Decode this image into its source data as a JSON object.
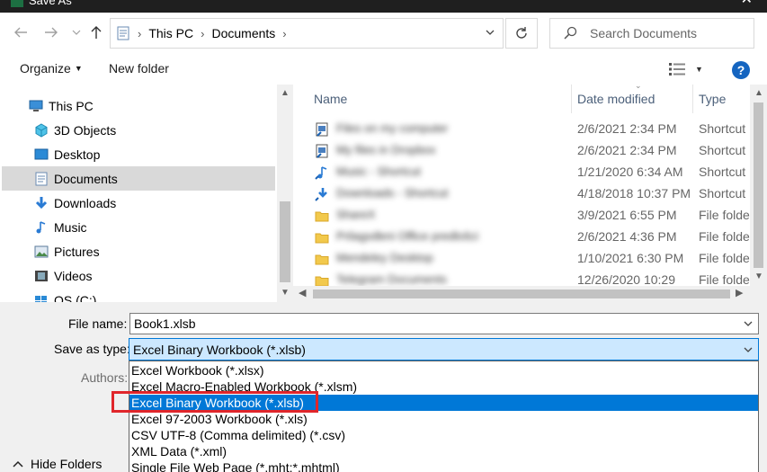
{
  "window": {
    "title": "Save As"
  },
  "address": {
    "crumbs": [
      "This PC",
      "Documents"
    ]
  },
  "search": {
    "placeholder": "Search Documents"
  },
  "toolbar": {
    "organize": "Organize",
    "new_folder": "New folder",
    "help": "?"
  },
  "nav": {
    "items": [
      {
        "label": "This PC",
        "icon": "computer-icon"
      },
      {
        "label": "3D Objects",
        "icon": "cube-icon"
      },
      {
        "label": "Desktop",
        "icon": "desktop-icon"
      },
      {
        "label": "Documents",
        "icon": "documents-icon",
        "selected": true
      },
      {
        "label": "Downloads",
        "icon": "download-icon"
      },
      {
        "label": "Music",
        "icon": "music-icon"
      },
      {
        "label": "Pictures",
        "icon": "pictures-icon"
      },
      {
        "label": "Videos",
        "icon": "videos-icon"
      },
      {
        "label": "OS (C:)",
        "icon": "drive-icon"
      }
    ]
  },
  "files": {
    "headers": {
      "name": "Name",
      "date": "Date modified",
      "type": "Type"
    },
    "rows": [
      {
        "name": "Files on my computer",
        "date": "2/6/2021 2:34 PM",
        "type": "Shortcut",
        "icon": "shortcut-icon"
      },
      {
        "name": "My files in Dropbox",
        "date": "2/6/2021 2:34 PM",
        "type": "Shortcut",
        "icon": "shortcut-icon"
      },
      {
        "name": "Music - Shortcut",
        "date": "1/21/2020 6:34 AM",
        "type": "Shortcut",
        "icon": "music-shortcut-icon"
      },
      {
        "name": "Downloads - Shortcut",
        "date": "4/18/2018 10:37 PM",
        "type": "Shortcut",
        "icon": "download-shortcut-icon"
      },
      {
        "name": "ShareX",
        "date": "3/9/2021 6:55 PM",
        "type": "File folder",
        "icon": "folder-icon"
      },
      {
        "name": "Prilagođeni Office predlošci",
        "date": "2/6/2021 4:36 PM",
        "type": "File folder",
        "icon": "folder-icon"
      },
      {
        "name": "Mendeley Desktop",
        "date": "1/10/2021 6:30 PM",
        "type": "File folder",
        "icon": "folder-icon"
      },
      {
        "name": "Telegram Documents",
        "date": "12/26/2020 10:29",
        "type": "File folder",
        "icon": "folder-icon"
      }
    ]
  },
  "form": {
    "file_name_label": "File name:",
    "file_name_value": "Book1.xlsb",
    "save_type_label": "Save as type:",
    "save_type_value": "Excel Binary Workbook (*.xlsb)",
    "authors_label": "Authors:",
    "hide_folders": "Hide Folders",
    "type_options": [
      "Excel Workbook (*.xlsx)",
      "Excel Macro-Enabled Workbook (*.xlsm)",
      "Excel Binary Workbook (*.xlsb)",
      "Excel 97-2003 Workbook (*.xls)",
      "CSV UTF-8 (Comma delimited) (*.csv)",
      "XML Data (*.xml)",
      "Single File Web Page (*.mht;*.mhtml)"
    ],
    "selected_option_index": 2
  },
  "colors": {
    "accent": "#0078d7",
    "highlight_box": "#e0262b",
    "selection_bg": "#cce8ff"
  }
}
